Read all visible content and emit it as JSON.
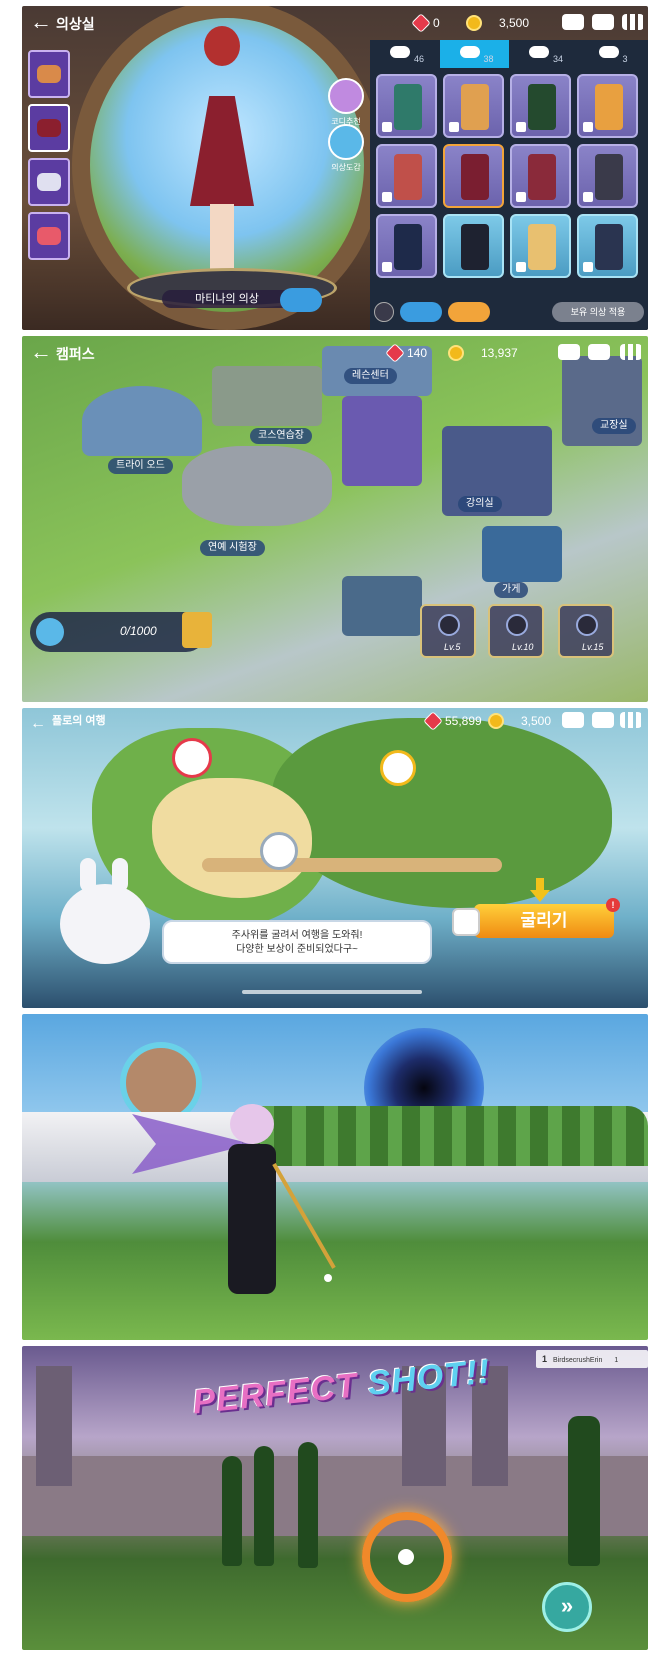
{
  "dressing_room": {
    "title": "의상실",
    "gems": "0",
    "coins": "3,500",
    "tabs": [
      {
        "count": "46"
      },
      {
        "count": "38"
      },
      {
        "count": "34"
      },
      {
        "count": "3"
      }
    ],
    "outfit_label": "마티나의 의상",
    "side_buttons": [
      "코디추천",
      "의상도감"
    ],
    "apply_button": "보유 의상 적용"
  },
  "campus": {
    "title": "캠퍼스",
    "gems": "140",
    "coins": "13,937",
    "buildings": [
      "레슨센터",
      "코스연습장",
      "트라이 오드",
      "연예 시험장",
      "강의실",
      "가게",
      "교장실"
    ],
    "quest_progress": "0/1000",
    "locked_slots": [
      "Lv.5",
      "Lv.10",
      "Lv.15"
    ]
  },
  "board": {
    "title": "플로의 여행",
    "gems": "55,899",
    "coins": "3,500",
    "bubble_line1": "주사위를 굴려서 여행을 도와줘!",
    "bubble_line2": "다양한 보상이 준비되었다구~",
    "roll_button": "굴리기",
    "badge": "!"
  },
  "swing": {},
  "perfect": {
    "text_pink": "PERFECT",
    "text_blue": "SHOT!!",
    "rank_pos": "1",
    "rank_name": "BirdsecrushErin",
    "rank_value": "1",
    "ffw": "»"
  }
}
